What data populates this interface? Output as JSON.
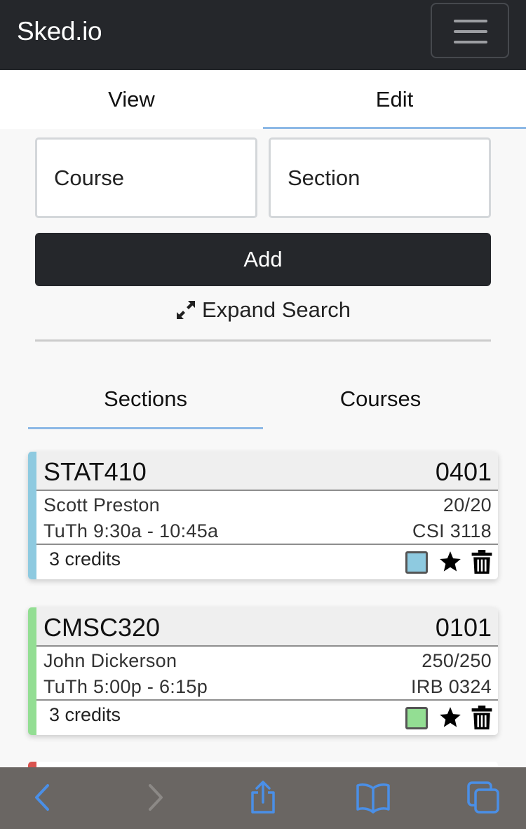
{
  "navbar": {
    "brand": "Sked.io",
    "menu_icon": "hamburger-menu-icon"
  },
  "main_tabs": [
    {
      "label": "View",
      "active": false
    },
    {
      "label": "Edit",
      "active": true
    }
  ],
  "search": {
    "course_placeholder": "Course",
    "section_placeholder": "Section",
    "add_label": "Add",
    "expand_label": "Expand Search",
    "expand_icon": "expand-arrows-icon"
  },
  "sub_tabs": [
    {
      "label": "Sections",
      "active": true
    },
    {
      "label": "Courses",
      "active": false
    }
  ],
  "sections": [
    {
      "course": "STAT410",
      "section": "0401",
      "instructor": "Scott Preston",
      "seats": "20/20",
      "time": "TuTh 9:30a - 10:45a",
      "room": "CSI 3118",
      "credits": "3 credits",
      "color": "#8ecae0"
    },
    {
      "course": "CMSC320",
      "section": "0101",
      "instructor": "John Dickerson",
      "seats": "250/250",
      "time": "TuTh 5:00p - 6:15p",
      "room": "IRB 0324",
      "credits": "3 credits",
      "color": "#93de93"
    },
    {
      "color": "#d9534f"
    }
  ],
  "colors": {
    "navbar": "#25272b",
    "accent_underline": "#8db9e6",
    "browser_icons": "#4a8fe7"
  },
  "browser_bar": {
    "icons": [
      "back-icon",
      "forward-icon",
      "share-icon",
      "bookmarks-icon",
      "tabs-icon"
    ]
  }
}
